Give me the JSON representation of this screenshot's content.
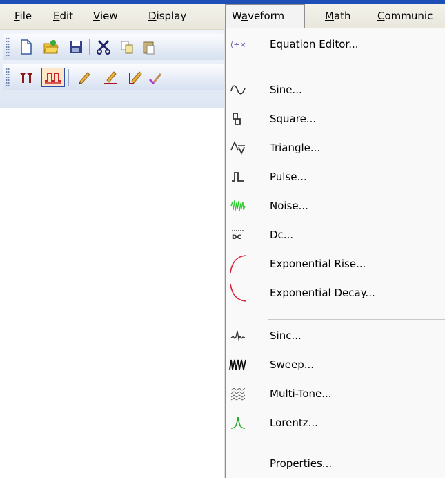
{
  "menubar": {
    "items": [
      {
        "label": "File",
        "mnemonic": "F"
      },
      {
        "label": "Edit",
        "mnemonic": "E"
      },
      {
        "label": "View",
        "mnemonic": "V"
      },
      {
        "label": "Display",
        "mnemonic": "D"
      },
      {
        "label": "Waveform",
        "mnemonic": "a"
      },
      {
        "label": "Math",
        "mnemonic": "M"
      },
      {
        "label": "Communic",
        "mnemonic": "C"
      }
    ],
    "active": "Waveform"
  },
  "toolbar": {
    "row1": [
      "new-file-icon",
      "open-folder-icon",
      "save-icon",
      "cut-icon",
      "copy-icon",
      "paste-icon"
    ],
    "row2": [
      "markers-icon",
      "waveform-view-icon",
      "pencil-icon",
      "line-draw-icon",
      "freehand-draw-icon",
      "eraser-icon"
    ]
  },
  "waveform_menu": {
    "items": [
      {
        "label": "Equation Editor...",
        "icon": "equation-icon"
      },
      {
        "label": "Sine...",
        "icon": "sine-icon"
      },
      {
        "label": "Square...",
        "icon": "square-icon"
      },
      {
        "label": "Triangle...",
        "icon": "triangle-icon"
      },
      {
        "label": "Pulse...",
        "icon": "pulse-icon"
      },
      {
        "label": "Noise...",
        "icon": "noise-icon"
      },
      {
        "label": "Dc...",
        "icon": "dc-icon"
      },
      {
        "label": "Exponential Rise...",
        "icon": "exp-rise-icon"
      },
      {
        "label": "Exponential Decay...",
        "icon": "exp-decay-icon"
      },
      {
        "label": "Sinc...",
        "icon": "sinc-icon"
      },
      {
        "label": "Sweep...",
        "icon": "sweep-icon"
      },
      {
        "label": "Multi-Tone...",
        "icon": "multitone-icon"
      },
      {
        "label": "Lorentz...",
        "icon": "lorentz-icon"
      },
      {
        "label": "Properties...",
        "icon": ""
      }
    ]
  },
  "colors": {
    "accent": "#1e4fb6",
    "noise": "#2ecc2e",
    "exp": "#d81e3a",
    "lorentz": "#1faa1f"
  }
}
